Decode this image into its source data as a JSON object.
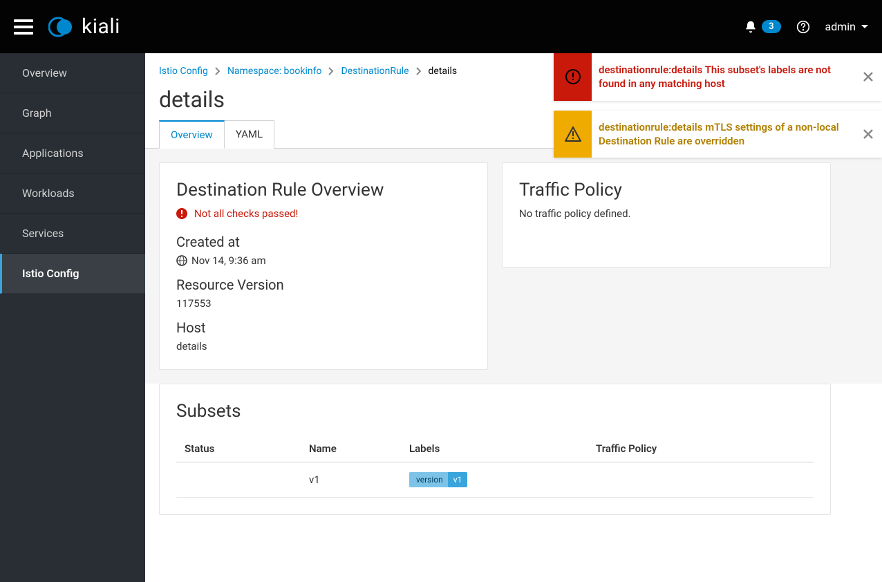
{
  "header": {
    "app_name": "kiali",
    "notification_count": "3",
    "user": "admin"
  },
  "sidebar": {
    "items": [
      {
        "label": "Overview"
      },
      {
        "label": "Graph"
      },
      {
        "label": "Applications"
      },
      {
        "label": "Workloads"
      },
      {
        "label": "Services"
      },
      {
        "label": "Istio Config",
        "active": true
      }
    ]
  },
  "breadcrumb": {
    "items": [
      "Istio Config",
      "Namespace: bookinfo",
      "DestinationRule"
    ],
    "current": "details"
  },
  "page_title": "details",
  "tabs": [
    {
      "label": "Overview",
      "active": true
    },
    {
      "label": "YAML"
    }
  ],
  "overview_card": {
    "title": "Destination Rule Overview",
    "status_text": "Not all checks passed!",
    "created_label": "Created at",
    "created_value": "Nov 14, 9:36 am",
    "resource_version_label": "Resource Version",
    "resource_version_value": "117553",
    "host_label": "Host",
    "host_value": "details"
  },
  "traffic_policy": {
    "title": "Traffic Policy",
    "none_text": "No traffic policy defined."
  },
  "subsets": {
    "title": "Subsets",
    "columns": [
      "Status",
      "Name",
      "Labels",
      "Traffic Policy"
    ],
    "rows": [
      {
        "status": "",
        "name": "v1",
        "label_key": "version",
        "label_val": "v1",
        "traffic_policy": ""
      }
    ]
  },
  "alerts": [
    {
      "type": "error",
      "text": "destinationrule:details This subset's labels are not found in any matching host"
    },
    {
      "type": "warn",
      "text": "destinationrule:details mTLS settings of a non-local Destination Rule are overridden"
    }
  ]
}
